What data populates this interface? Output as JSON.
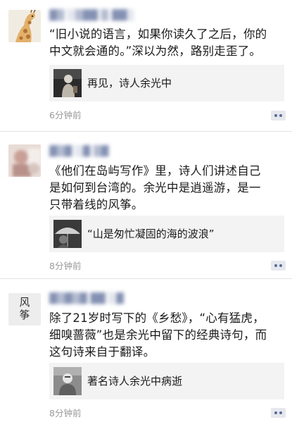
{
  "posts": [
    {
      "username": "▓▒ ░▒▓▓ ▒ ▓▓░",
      "text": "“旧小说的语言，如果你读久了之后，你的中文就会通的。”深以为然，路别走歪了。",
      "text_lines": [
        "“旧小说的语言，如果你读久了之后，你的",
        "中文就会通的。”深以为然，路别走歪了。"
      ],
      "link_title": "再见，诗人余光中",
      "time": "6分钟前"
    },
    {
      "username": "▓▒▓ ░▓ ▒▓",
      "text": "《他们在岛屿写作》里，诗人们讲述自己是如何到台湾的。余光中是逍遥游，是一只带着线的风筝。",
      "text_lines": [
        "《他们在岛屿写作》里，诗人们讲述自己",
        "是如何到台湾的。余光中是逍遥游，是一",
        "只带着线的风筝。"
      ],
      "link_title": "“山是匆忙凝固的海的波浪”",
      "time": "8分钟前"
    },
    {
      "username": "▓▒▓▒▓ ▓▓ ░▓",
      "avatar_text": [
        "风",
        "筝"
      ],
      "text": "除了21岁时写下的《乡愁》，“心有猛虎，细嗅蔷薇”也是余光中留下的经典诗句，而这句诗来自于翻译。",
      "text_lines": [
        "除了21岁时写下的《乡愁》，“心有猛虎，",
        "细嗅蔷薇”也是余光中留下的经典诗句，而",
        "这句诗来自于翻译。"
      ],
      "link_title": "著名诗人余光中病逝",
      "time": "8分钟前"
    }
  ],
  "icons": {
    "more": "more-dots-icon"
  },
  "colors": {
    "username": "#6a7aa2",
    "text": "#1a1a1a",
    "time": "#999999",
    "card_bg": "#f3f3f3",
    "more_button_bg": "#e6e8ee",
    "more_dot": "#586b95"
  }
}
